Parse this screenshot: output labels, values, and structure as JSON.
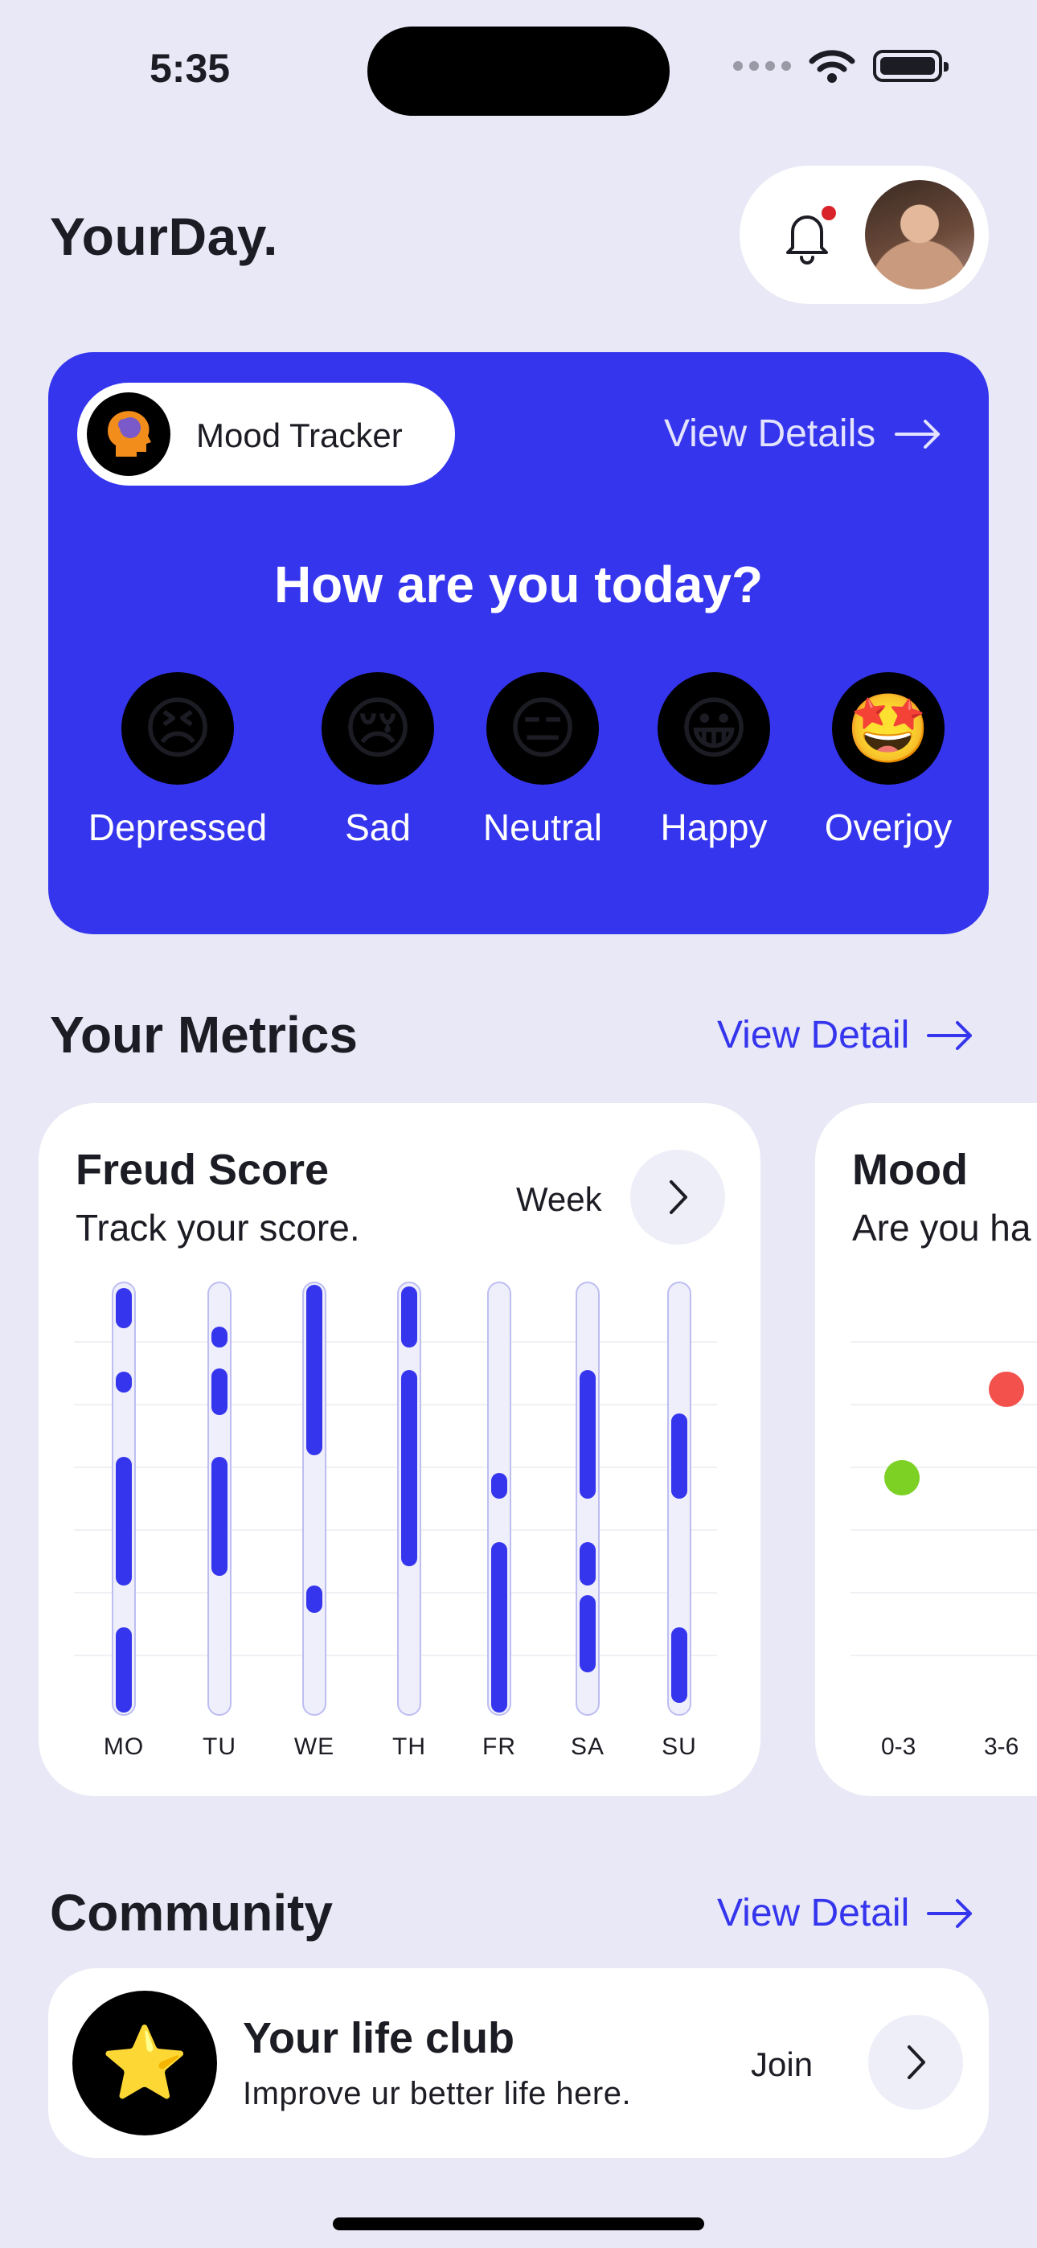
{
  "status_bar": {
    "time": "5:35"
  },
  "header": {
    "title": "YourDay."
  },
  "mood_tracker": {
    "badge_label": "Mood Tracker",
    "view_details": "View Details",
    "question": "How are you today?",
    "options": [
      {
        "emoji": "😣",
        "label": "Depressed"
      },
      {
        "emoji": "😢",
        "label": "Sad"
      },
      {
        "emoji": "😑",
        "label": "Neutral"
      },
      {
        "emoji": "😀",
        "label": "Happy"
      },
      {
        "emoji": "🤩",
        "label": "Overjoy"
      }
    ]
  },
  "metrics": {
    "title": "Your Metrics",
    "view_detail": "View Detail",
    "freud_card": {
      "title": "Freud Score",
      "subtitle": "Track your score.",
      "period": "Week",
      "days": [
        "MO",
        "TU",
        "WE",
        "TH",
        "FR",
        "SA",
        "SU"
      ]
    },
    "mood_card": {
      "title": "Mood",
      "subtitle": "Are you ha",
      "x_labels": [
        "0-3",
        "3-6"
      ]
    }
  },
  "community": {
    "title": "Community",
    "view_detail": "View Detail",
    "club": {
      "icon": "⭐",
      "title": "Your life club",
      "subtitle": "Improve ur better life here.",
      "action": "Join"
    }
  },
  "colors": {
    "accent": "#3535EE",
    "background": "#E8E8F6",
    "notification": "#D8232A",
    "mood_red": "#F2524B",
    "mood_green": "#7CD124"
  }
}
